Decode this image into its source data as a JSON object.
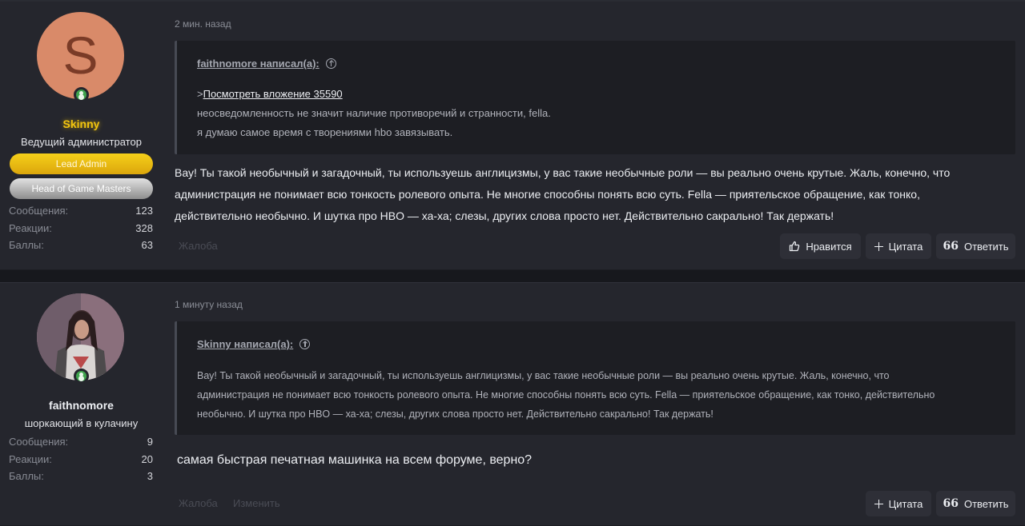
{
  "posts": [
    {
      "user": {
        "avatar_letter": "S",
        "name": "Skinny",
        "title": "Ведущий администратор",
        "badges": [
          "Lead Admin",
          "Head of Game Masters"
        ],
        "stats": [
          {
            "label": "Сообщения:",
            "value": "123"
          },
          {
            "label": "Реакции:",
            "value": "328"
          },
          {
            "label": "Баллы:",
            "value": "63"
          }
        ]
      },
      "date": "2 мин. назад",
      "quote": {
        "author": "faithnomore написал(а):",
        "link_prefix": ">",
        "link": "Посмотреть вложение 35590",
        "lines": [
          "неосведомленность не значит наличие противоречий и странности, fella.",
          "я думаю самое время с творениями hbo завязывать."
        ]
      },
      "message": [
        "Вау! Ты такой необычный и загадочный, ты используешь англицизмы, у вас такие необычные роли — вы реально очень крутые. Жаль, конечно, что",
        "администрация не понимает всю тонкость ролевого опыта. Не многие способны понять всю суть. Fella — приятельское обращение, как тонко,",
        "действительно необычно. И шутка про HBO — ха-ха; слезы, других слова просто нет. Действительно сакрально! Так держать!"
      ],
      "footer_links": [
        "Жалоба"
      ],
      "buttons": {
        "like": "Нравится",
        "quote": "Цитата",
        "reply": "Ответить"
      }
    },
    {
      "user": {
        "name": "faithnomore",
        "title": "шоркающий в кулачину",
        "stats": [
          {
            "label": "Сообщения:",
            "value": "9"
          },
          {
            "label": "Реакции:",
            "value": "20"
          },
          {
            "label": "Баллы:",
            "value": "3"
          }
        ]
      },
      "date": "1 минуту назад",
      "quote": {
        "author": "Skinny написал(а):",
        "lines": [
          "Вау! Ты такой необычный и загадочный, ты используешь англицизмы, у вас такие необычные роли — вы реально очень крутые. Жаль, конечно, что",
          "администрация не понимает всю тонкость ролевого опыта. Не многие способны понять всю суть. Fella — приятельское обращение, как тонко, действительно",
          "необычно. И шутка про HBO — ха-ха; слезы, других слова просто нет. Действительно сакрально! Так держать!"
        ]
      },
      "message": [
        "самая быстрая печатная машинка на всем форуме, верно?"
      ],
      "footer_links": [
        "Жалоба",
        "Изменить"
      ],
      "buttons": {
        "quote": "Цитата",
        "reply": "Ответить"
      }
    }
  ],
  "colors": {
    "background": "#17181d",
    "post_bg": "#25262d",
    "quote_bg": "#1d1e23",
    "admin_name": "#f2c40f",
    "online": "#3fa34d"
  }
}
